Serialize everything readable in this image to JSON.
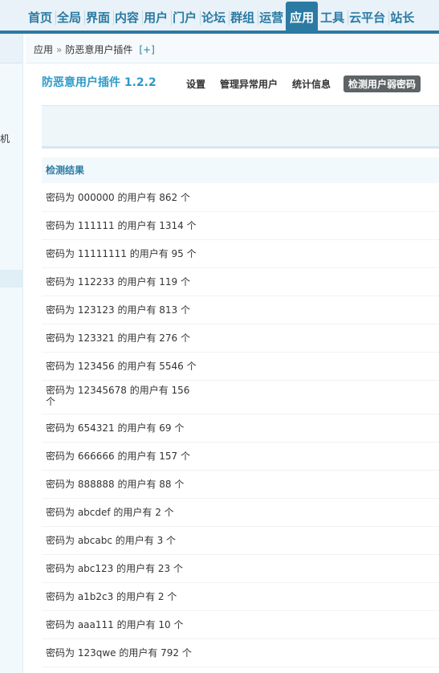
{
  "nav": [
    {
      "label": "首页"
    },
    {
      "label": "全局"
    },
    {
      "label": "界面"
    },
    {
      "label": "内容"
    },
    {
      "label": "用户"
    },
    {
      "label": "门户"
    },
    {
      "label": "论坛"
    },
    {
      "label": "群组"
    },
    {
      "label": "运营"
    },
    {
      "label": "应用",
      "active": true
    },
    {
      "label": "工具"
    },
    {
      "label": "云平台"
    },
    {
      "label": "站长"
    }
  ],
  "sidebar": {
    "partial_text": "机"
  },
  "breadcrumb": {
    "root": "应用",
    "separator": "»",
    "current": "防恶意用户插件",
    "add": "[+]"
  },
  "plugin": {
    "title": "防恶意用户插件  1.2.2",
    "tabs": [
      {
        "label": "设置"
      },
      {
        "label": "管理异常用户"
      },
      {
        "label": "统计信息"
      },
      {
        "label": "检测用户弱密码",
        "active": true
      }
    ]
  },
  "results": {
    "heading": "检测结果",
    "rows": [
      {
        "text": "密码为 000000 的用户有 862 个"
      },
      {
        "text": "密码为 111111 的用户有 1314 个"
      },
      {
        "text": "密码为 11111111 的用户有 95 个"
      },
      {
        "text": "密码为 112233 的用户有 119 个"
      },
      {
        "text": "密码为 123123 的用户有 813 个"
      },
      {
        "text": "密码为 123321 的用户有 276 个"
      },
      {
        "text": "密码为 123456 的用户有 5546 个"
      },
      {
        "text": "密码为 12345678 的用户有 156 个",
        "tall": true
      },
      {
        "text": "密码为 654321 的用户有 69 个"
      },
      {
        "text": "密码为 666666 的用户有 157 个"
      },
      {
        "text": "密码为 888888 的用户有 88 个"
      },
      {
        "text": "密码为 abcdef 的用户有 2 个"
      },
      {
        "text": "密码为 abcabc 的用户有 3 个"
      },
      {
        "text": "密码为 abc123 的用户有 23 个"
      },
      {
        "text": "密码为 a1b2c3 的用户有 2 个"
      },
      {
        "text": "密码为 aaa111 的用户有 10 个"
      },
      {
        "text": "密码为 123qwe 的用户有 792 个"
      }
    ]
  }
}
